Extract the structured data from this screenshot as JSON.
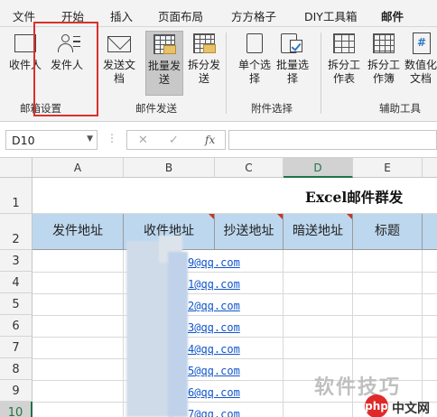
{
  "menu": {
    "tabs": [
      "文件",
      "开始",
      "插入",
      "页面布局",
      "方方格子",
      "DIY工具箱",
      "邮件"
    ],
    "active": "邮件"
  },
  "ribbon": {
    "groups": [
      {
        "label": "邮箱设置",
        "buttons": [
          {
            "label": "收件人",
            "icon": "recipient-icon"
          },
          {
            "label": "发件人",
            "icon": "sender-icon"
          }
        ]
      },
      {
        "label": "邮件发送",
        "buttons": [
          {
            "label": "发送文档",
            "icon": "envelope-icon"
          },
          {
            "label": "批量发送",
            "icon": "bulk-send-icon",
            "pressed": true
          },
          {
            "label": "拆分发送",
            "icon": "split-send-icon"
          }
        ]
      },
      {
        "label": "附件选择",
        "buttons": [
          {
            "label": "单个选择",
            "icon": "clipboard-icon"
          },
          {
            "label": "批量选择",
            "icon": "checklist-icon"
          }
        ]
      },
      {
        "label": "辅助工具",
        "buttons": [
          {
            "label": "拆分工作表",
            "icon": "split-sheet-icon"
          },
          {
            "label": "拆分工作簿",
            "icon": "split-workbook-icon"
          },
          {
            "label": "数值化文档",
            "icon": "numeric-doc-icon"
          }
        ]
      }
    ]
  },
  "formula_bar": {
    "name_box": "D10",
    "dots": "⋮",
    "cancel": "✕",
    "confirm": "✓",
    "fx": "fx",
    "formula": ""
  },
  "sheet": {
    "columns": [
      "A",
      "B",
      "C",
      "D",
      "E"
    ],
    "selected_column": "D",
    "rows": [
      "1",
      "2",
      "3",
      "4",
      "5",
      "6",
      "7",
      "8",
      "9",
      "10"
    ],
    "selected_row": "10",
    "title": "Excel邮件群发",
    "headers": [
      "发件地址",
      "收件地址",
      "抄送地址",
      "暗送地址",
      "标题"
    ],
    "emails": [
      "9@qq.com",
      "1@qq.com",
      "2@qq.com",
      "3@qq.com",
      "4@qq.com",
      "5@qq.com",
      "6@qq.com",
      "7@qq.com"
    ]
  },
  "watermark": {
    "text": "软件技巧",
    "logo": "php",
    "site": "中文网"
  },
  "colors": {
    "accent": "#217346",
    "header_fill": "#bdd7ee",
    "highlight_box": "#d9302c",
    "link": "#1155cc"
  }
}
